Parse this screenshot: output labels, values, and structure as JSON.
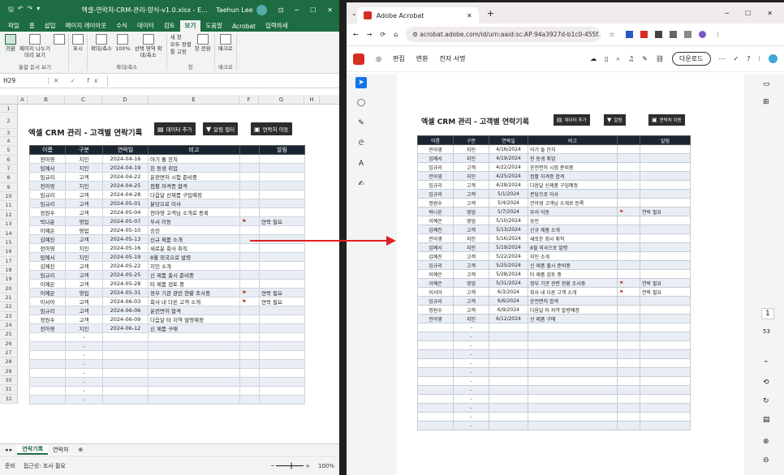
{
  "excel": {
    "title": {
      "filename": "엑셀-연락처-CRM-관리-양식-v1.0.xlsx  -  E...",
      "user": "Taehun Lee"
    },
    "tabs": [
      "파일",
      "홈",
      "삽입",
      "페이지 레이아웃",
      "수식",
      "데이터",
      "검토",
      "보기",
      "도움말",
      "Acrobat",
      "입력하세"
    ],
    "active_tab": "보기",
    "ribbon": {
      "groups": [
        {
          "name": "통합 문서 보기",
          "buttons": [
            "기본",
            "페이지 나누기 미리 보기",
            ""
          ]
        },
        {
          "name": "",
          "buttons": [
            "표시"
          ]
        },
        {
          "name": "확대/축소",
          "buttons": [
            "확대/축소",
            "100%",
            "선택 영역 확대/축소"
          ]
        },
        {
          "name": "창",
          "buttons": [
            "새 창",
            "모두 정렬",
            "틀 고정",
            "창 전환"
          ]
        },
        {
          "name": "매크로",
          "buttons": [
            "매크로"
          ]
        }
      ]
    },
    "name_box": "H29",
    "fx": "✕ ✓ fx",
    "columns": [
      "A",
      "B",
      "C",
      "D",
      "E",
      "F",
      "G",
      "H"
    ],
    "sheet_title": "엑셀 CRM 관리 - 고객별 연락기록",
    "buttons": [
      "데이터 추가",
      "알림 필터",
      "연락처 이동"
    ],
    "table_headers": [
      "이름",
      "구분",
      "연락일",
      "비고",
      "",
      "알림"
    ],
    "rows": [
      [
        "전아영",
        "지인",
        "2024-04-16",
        "아기 돌 잔치",
        "",
        ""
      ],
      [
        "임예서",
        "지인",
        "2024-04-19",
        "친 동생 취업",
        "",
        ""
      ],
      [
        "임규리",
        "고객",
        "2024-04-22",
        "운전면허 시험 준비중",
        "",
        ""
      ],
      [
        "전아영",
        "지인",
        "2024-04-25",
        "컴활 자격증 합격",
        "",
        ""
      ],
      [
        "임규리",
        "고객",
        "2024-04-28",
        "다음달 신제품 구입예정",
        "",
        ""
      ],
      [
        "임규리",
        "고객",
        "2024-05-01",
        "분당으로 이사",
        "",
        ""
      ],
      [
        "정원수",
        "고객",
        "2024-05-04",
        "전아영 고객님 소개로 등록",
        "",
        ""
      ],
      [
        "박나윤",
        "영업",
        "2024-05-07",
        "부서 이동",
        "⚑",
        "연락 필요"
      ],
      [
        "이예은",
        "영업",
        "2024-05-10",
        "승진",
        "",
        ""
      ],
      [
        "김예진",
        "고객",
        "2024-05-13",
        "신규 제품 소개",
        "",
        ""
      ],
      [
        "전아영",
        "지인",
        "2024-05-16",
        "새로운 회사 취직",
        "",
        ""
      ],
      [
        "임예서",
        "지인",
        "2024-05-19",
        "8월 외국으로 발령",
        "",
        ""
      ],
      [
        "김예진",
        "고객",
        "2024-05-22",
        "지인 소개",
        "",
        ""
      ],
      [
        "임규리",
        "고객",
        "2024-05-25",
        "신 제품 출시 준비중",
        "",
        ""
      ],
      [
        "이예은",
        "고객",
        "2024-05-28",
        "타 제품 검토 중",
        "",
        ""
      ],
      [
        "이예은",
        "영업",
        "2024-05-31",
        "정부 기관 관련 현황 조사중",
        "⚑",
        "연락 필요"
      ],
      [
        "이서아",
        "고객",
        "2024-06-03",
        "회사 내 다른 고객 소개",
        "⚑",
        "연락 필요"
      ],
      [
        "임규리",
        "고객",
        "2024-06-06",
        "운전면허 합격",
        "",
        ""
      ],
      [
        "정원수",
        "고객",
        "2024-06-09",
        "다음달 타 지역 발령예정",
        "",
        ""
      ],
      [
        "전아영",
        "지인",
        "2024-06-12",
        "신 제품 구매",
        "",
        ""
      ],
      [
        "",
        "-",
        "",
        "",
        "",
        ""
      ],
      [
        "",
        "-",
        "",
        "",
        "",
        ""
      ],
      [
        "",
        "-",
        "",
        "",
        "",
        ""
      ],
      [
        "",
        "-",
        "",
        "",
        "",
        ""
      ],
      [
        "",
        "-",
        "",
        "",
        "",
        ""
      ],
      [
        "",
        "-",
        "",
        "",
        "",
        ""
      ],
      [
        "",
        "-",
        "",
        "",
        "",
        ""
      ],
      [
        "",
        "-",
        "",
        "",
        "",
        ""
      ]
    ],
    "row_numbers": [
      "1",
      "2",
      "3",
      "4",
      "5",
      "6",
      "7",
      "8",
      "9",
      "10",
      "11",
      "12",
      "13",
      "14",
      "15",
      "16",
      "17",
      "18",
      "19",
      "20",
      "21",
      "22",
      "23",
      "24",
      "25",
      "26",
      "27",
      "28",
      "29",
      "30",
      "31",
      "32"
    ],
    "sheet_tabs": [
      "연락기록",
      "연락처"
    ],
    "active_sheet": "연락기록",
    "status": {
      "ready": "준비",
      "accessibility": "접근성: 조사 필요",
      "zoom": "100%"
    }
  },
  "browser": {
    "tab_title": "Adobe Acrobat",
    "url": "acrobat.adobe.com/id/urn:aaid:sc:AP:94a3927d-b1c0-455f...",
    "toolbar": {
      "menu": [
        "편집",
        "변환",
        "전자 서명"
      ],
      "download": "다운로드"
    },
    "page_number": "1",
    "total_pages": "53",
    "pdf": {
      "title": "엑셀 CRM 관리 - 고객별 연락기록",
      "buttons": [
        "데이터 추가",
        "알림",
        "연락처 이동"
      ],
      "headers": [
        "이름",
        "구분",
        "연락일",
        "비고",
        "",
        "알림"
      ],
      "rows": [
        [
          "전아영",
          "지인",
          "4/16/2024",
          "아기 돌 잔치",
          "",
          ""
        ],
        [
          "임예서",
          "지인",
          "4/19/2024",
          "친 동생 취업",
          "",
          ""
        ],
        [
          "임규리",
          "고객",
          "4/22/2024",
          "운전면허 시험 준비중",
          "",
          ""
        ],
        [
          "전아영",
          "지인",
          "4/25/2024",
          "컴활 자격증 합격",
          "",
          ""
        ],
        [
          "임규리",
          "고객",
          "4/28/2024",
          "다음달 신제품 구입예정",
          "",
          ""
        ],
        [
          "임규리",
          "고객",
          "5/1/2024",
          "분당으로 이사",
          "",
          ""
        ],
        [
          "정원수",
          "고객",
          "5/4/2024",
          "전아영 고객님 소개로 등록",
          "",
          ""
        ],
        [
          "박나윤",
          "영업",
          "5/7/2024",
          "부서 이동",
          "⚑",
          "연락 필요"
        ],
        [
          "이예은",
          "영업",
          "5/10/2024",
          "승진",
          "",
          ""
        ],
        [
          "김예진",
          "고객",
          "5/13/2024",
          "신규 제품 소개",
          "",
          ""
        ],
        [
          "전아영",
          "지인",
          "5/16/2024",
          "새로운 회사 취직",
          "",
          ""
        ],
        [
          "임예서",
          "지인",
          "5/19/2024",
          "8월 외국으로 발령",
          "",
          ""
        ],
        [
          "김예진",
          "고객",
          "5/22/2024",
          "지인 소개",
          "",
          ""
        ],
        [
          "임규리",
          "고객",
          "5/25/2024",
          "신 제품 출시 준비중",
          "",
          ""
        ],
        [
          "이예은",
          "고객",
          "5/28/2024",
          "타 제품 검토 중",
          "",
          ""
        ],
        [
          "이예은",
          "영업",
          "5/31/2024",
          "정부 기관 관련 현황 조사중",
          "⚑",
          "연락 필요"
        ],
        [
          "이서아",
          "고객",
          "6/3/2024",
          "회사 내 다른 고객 소개",
          "⚑",
          "연락 필요"
        ],
        [
          "임규리",
          "고객",
          "6/6/2024",
          "운전면허 합격",
          "",
          ""
        ],
        [
          "정원수",
          "고객",
          "6/9/2024",
          "다음달 타 지역 발령예정",
          "",
          ""
        ],
        [
          "전아영",
          "지인",
          "6/12/2024",
          "신 제품 구매",
          "",
          ""
        ],
        [
          "",
          "-",
          "",
          "",
          "",
          ""
        ],
        [
          "",
          "-",
          "",
          "",
          "",
          ""
        ],
        [
          "",
          "-",
          "",
          "",
          "",
          ""
        ],
        [
          "",
          "-",
          "",
          "",
          "",
          ""
        ],
        [
          "",
          "-",
          "",
          "",
          "",
          ""
        ],
        [
          "",
          "-",
          "",
          "",
          "",
          ""
        ],
        [
          "",
          "-",
          "",
          "",
          "",
          ""
        ],
        [
          "",
          "-",
          "",
          "",
          "",
          ""
        ],
        [
          "",
          "-",
          "",
          "",
          "",
          ""
        ],
        [
          "",
          "-",
          "",
          "",
          "",
          ""
        ],
        [
          "",
          "-",
          "",
          "",
          "",
          ""
        ],
        [
          "",
          "-",
          "",
          "",
          "",
          ""
        ]
      ]
    }
  },
  "colors": {
    "excel_green": "#1e6c41",
    "table_header": "#1b2431",
    "alt_row": "#e9eef5",
    "arrow": "#e02020",
    "acrobat_red": "#d82d22",
    "flag": "#c0392b"
  }
}
